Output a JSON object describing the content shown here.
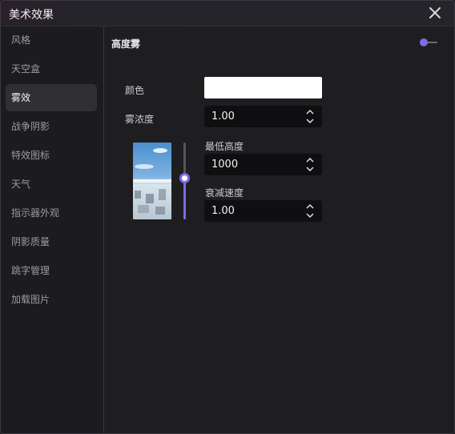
{
  "window": {
    "title": "美术效果",
    "close_icon": "close-icon"
  },
  "sidebar": {
    "items": [
      {
        "label": "风格",
        "active": false
      },
      {
        "label": "天空盒",
        "active": false
      },
      {
        "label": "雾效",
        "active": true
      },
      {
        "label": "战争阴影",
        "active": false
      },
      {
        "label": "特效图标",
        "active": false
      },
      {
        "label": "天气",
        "active": false
      },
      {
        "label": "指示器外观",
        "active": false
      },
      {
        "label": "阴影质量",
        "active": false
      },
      {
        "label": "跳字管理",
        "active": false
      },
      {
        "label": "加载图片",
        "active": false
      }
    ]
  },
  "fog": {
    "section_title": "高度雾",
    "toggle_on": true,
    "color_label": "颜色",
    "color_value": "#ffffff",
    "density_label": "雾浓度",
    "density_value": "1.00",
    "min_height_label": "最低高度",
    "min_height_value": "1000",
    "decay_label": "衰减速度",
    "decay_value": "1.00",
    "height_slider_fraction": 0.53
  },
  "colors": {
    "accent": "#7e6ae6",
    "background": "#1e1e21",
    "sidebar_active": "#2f2f34"
  }
}
